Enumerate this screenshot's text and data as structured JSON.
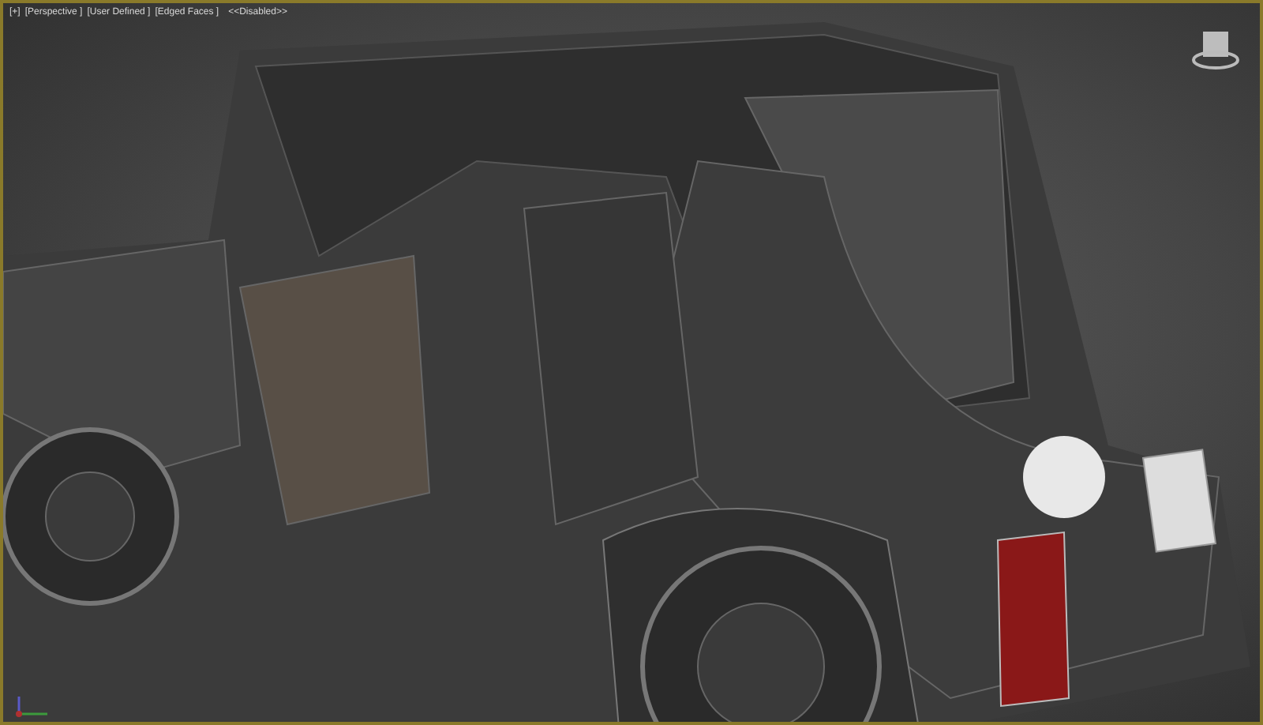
{
  "viewport": {
    "labels": [
      "[+]",
      "[Perspective ]",
      "[User Defined ]",
      "[Edged Faces ]"
    ],
    "status": "<<Disabled>>",
    "active": true
  }
}
